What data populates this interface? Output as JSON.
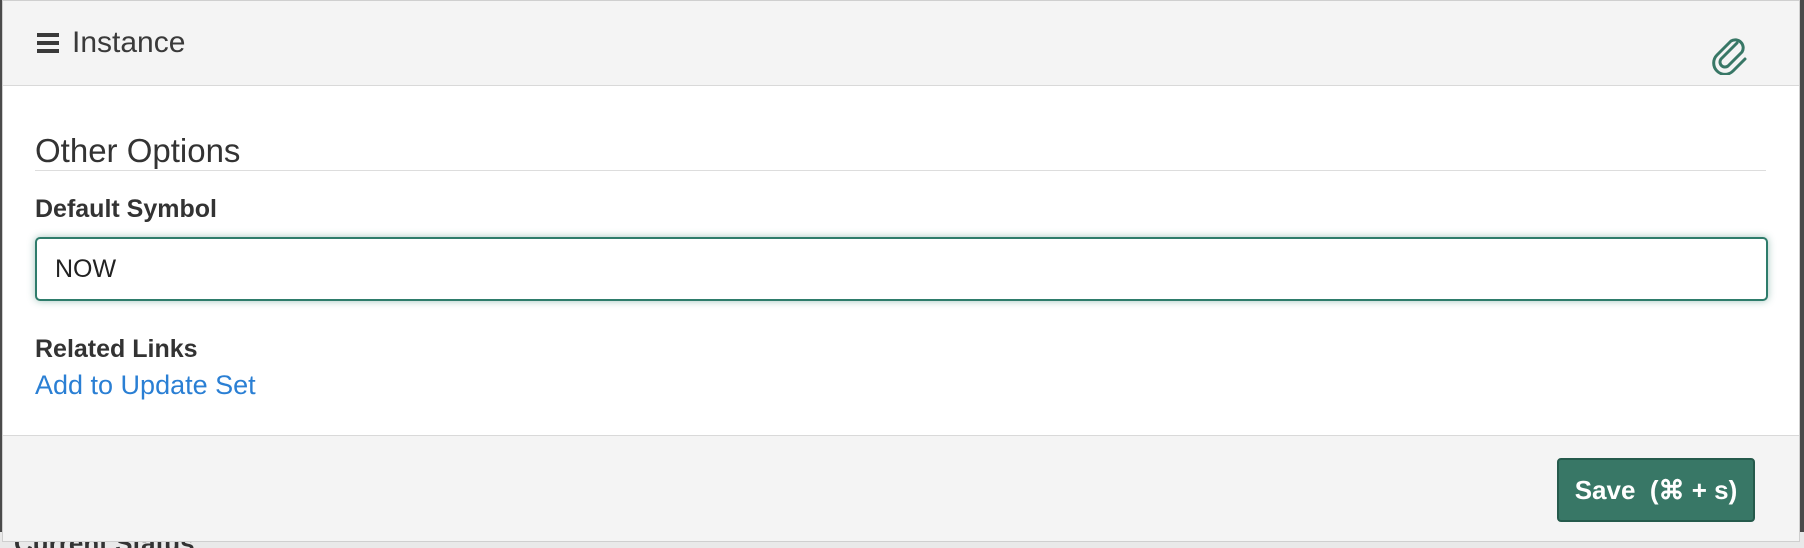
{
  "background": {
    "partial_text": "Current Status"
  },
  "header": {
    "title": "Instance",
    "menu_icon": "hamburger-menu-icon",
    "attachment_icon": "paperclip-icon"
  },
  "section": {
    "title": "Other Options"
  },
  "field": {
    "label": "Default Symbol",
    "value": "NOW"
  },
  "related": {
    "label": "Related Links",
    "link_text": "Add to Update Set"
  },
  "footer": {
    "save_label": "Save  (⌘ + s)"
  },
  "colors": {
    "accent": "#387766",
    "focus_border": "#2e7c6b",
    "link": "#2a7fd4",
    "header_bg": "#f4f4f4"
  }
}
